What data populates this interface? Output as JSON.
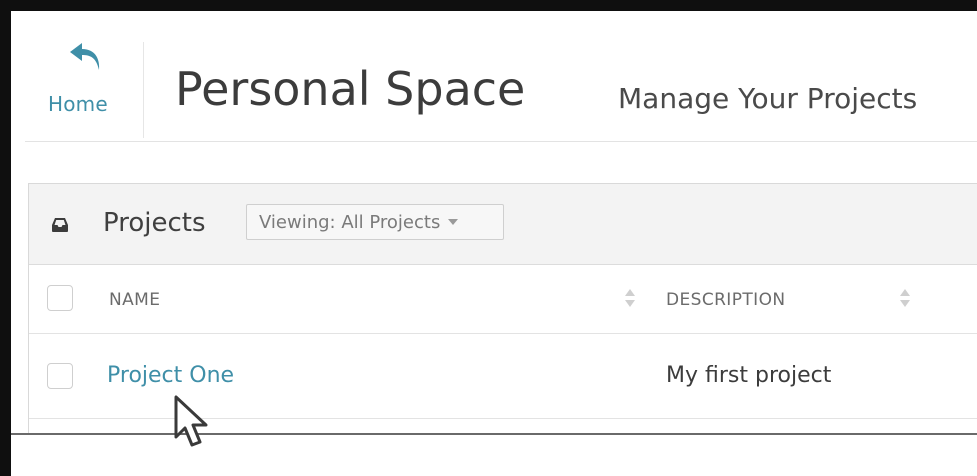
{
  "header": {
    "home_label": "Home",
    "title": "Personal Space",
    "subtitle": "Manage Your Projects"
  },
  "panel": {
    "title": "Projects",
    "filter_label": "Viewing: All Projects"
  },
  "table": {
    "columns": [
      "NAME",
      "DESCRIPTION"
    ],
    "rows": [
      {
        "name": "Project One",
        "description": "My first project"
      }
    ]
  },
  "icons": {
    "home": "undo-arrow-icon",
    "panel": "inbox-icon",
    "sort": "sort-icon",
    "cursor": "mouse-pointer-icon"
  },
  "colors": {
    "link": "#3f8fa8",
    "header_bg": "#f3f3f3",
    "text": "#3c3c3c"
  }
}
